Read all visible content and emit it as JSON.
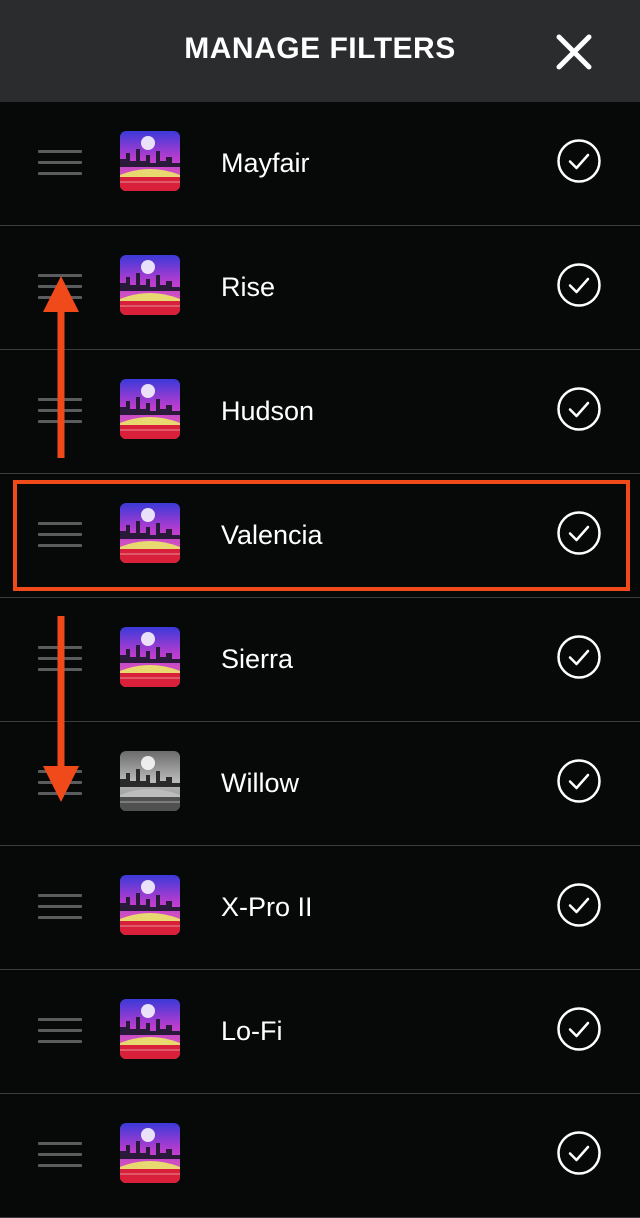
{
  "header": {
    "title": "MANAGE FILTERS",
    "close_icon": "close-icon"
  },
  "filters": [
    {
      "name": "Mayfair",
      "checked": true,
      "thumbnail": "color"
    },
    {
      "name": "Rise",
      "checked": true,
      "thumbnail": "color"
    },
    {
      "name": "Hudson",
      "checked": true,
      "thumbnail": "color"
    },
    {
      "name": "Valencia",
      "checked": true,
      "thumbnail": "color"
    },
    {
      "name": "Sierra",
      "checked": true,
      "thumbnail": "color"
    },
    {
      "name": "Willow",
      "checked": true,
      "thumbnail": "grayscale"
    },
    {
      "name": "X-Pro II",
      "checked": true,
      "thumbnail": "color"
    },
    {
      "name": "Lo-Fi",
      "checked": true,
      "thumbnail": "color"
    },
    {
      "name": "",
      "checked": true,
      "thumbnail": "color"
    }
  ],
  "annotations": {
    "highlighted_item": "Valencia",
    "arrow_up_icon": "arrow-up-icon",
    "arrow_down_icon": "arrow-down-icon",
    "accent_color": "#f04a1a"
  },
  "colors": {
    "background": "#070808",
    "header_background": "#2a2c2e",
    "divider": "#3a3c3e",
    "text": "#ffffff"
  }
}
